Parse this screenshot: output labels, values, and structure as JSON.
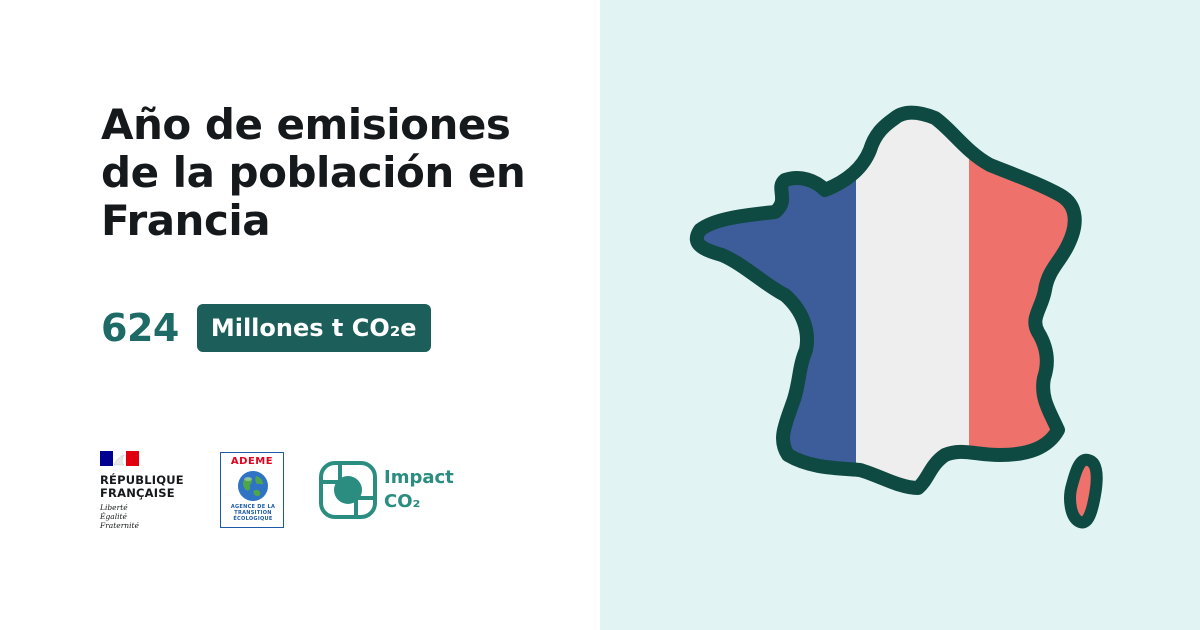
{
  "title": "Año de emisiones de la población en Francia",
  "value": "624",
  "unit": "Millones t CO₂e",
  "colors": {
    "accent": "#1d6a66",
    "badge_bg": "#1c5f5a",
    "panel_bg": "#e1f3f3",
    "flag_blue": "#3d5c9a",
    "flag_white": "#eeeeee",
    "flag_red": "#ee716b",
    "outline": "#0e4a42"
  },
  "logos": {
    "republique": {
      "name": "RÉPUBLIQUE FRANÇAISE",
      "motto": [
        "Liberté",
        "Égalité",
        "Fraternité"
      ]
    },
    "ademe": {
      "name": "ADEME",
      "subtitle": "AGENCE DE LA TRANSITION ÉCOLOGIQUE"
    },
    "impact_co2": {
      "line1": "Impact",
      "line2": "CO₂"
    }
  },
  "illustration": {
    "icon": "france-map-flag-icon"
  }
}
